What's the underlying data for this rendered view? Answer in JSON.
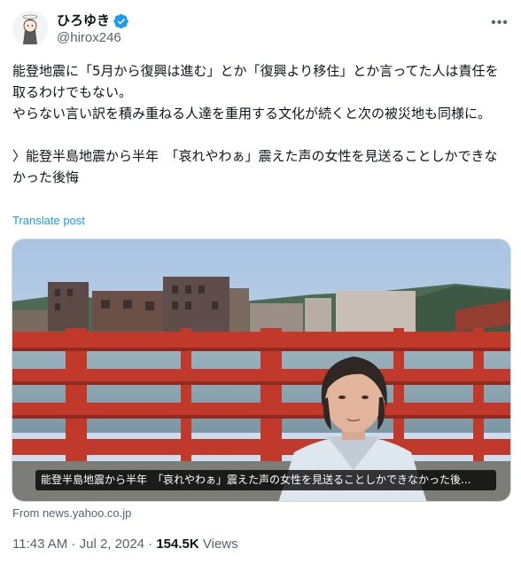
{
  "author": {
    "display_name": "ひろゆき",
    "handle": "@hirox246",
    "verified": true
  },
  "icons": {
    "verified": "verified-badge-icon",
    "more": "more-options-icon",
    "avatar": "avatar-illustration"
  },
  "tweet": {
    "text": "能登地震に「5月から復興は進む」とか「復興より移住」とか言ってた人は責任を取るわけでもない。\nやらない言い訳を積み重ねる人達を重用する文化が続くと次の被災地も同様に。\n\n〉能登半島地震から半年　「哀れやわぁ」震えた声の女性を見送ることしかできなかった後悔",
    "translate_label": "Translate post"
  },
  "media": {
    "caption": "能登半島地震から半年　「哀れやわぁ」震えた声の女性を見送ることしかできなかった後..."
  },
  "link_source": "From news.yahoo.co.jp",
  "meta": {
    "time": "11:43 AM",
    "separator": " · ",
    "date": "Jul 2, 2024",
    "views_count": "154.5K",
    "views_label": " Views"
  },
  "colors": {
    "accent": "#1d9bf0",
    "text": "#0f1419",
    "secondary": "#536471",
    "bridge_red": "#c0392b"
  }
}
